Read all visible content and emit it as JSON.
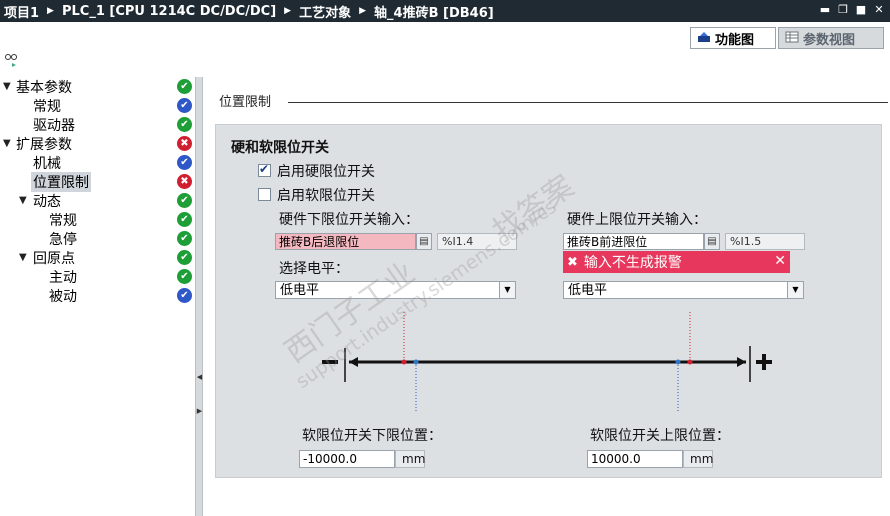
{
  "titlebar": {
    "crumbs": [
      "项目1",
      "PLC_1 [CPU 1214C DC/DC/DC]",
      "工艺对象",
      "轴_4推砖B [DB46]"
    ],
    "win_buttons": [
      "minimize",
      "restore",
      "maximize",
      "close"
    ]
  },
  "tabs": [
    {
      "label": "功能图",
      "icon": "function-view-icon",
      "active": true
    },
    {
      "label": "参数视图",
      "icon": "parameter-view-icon",
      "active": false
    }
  ],
  "tree": {
    "items": [
      {
        "label": "基本参数",
        "level": 0,
        "expanded": true,
        "status": "ok"
      },
      {
        "label": "常规",
        "level": 1,
        "status": "info"
      },
      {
        "label": "驱动器",
        "level": 1,
        "status": "ok"
      },
      {
        "label": "扩展参数",
        "level": 0,
        "expanded": true,
        "status": "err"
      },
      {
        "label": "机械",
        "level": 1,
        "status": "info"
      },
      {
        "label": "位置限制",
        "level": 1,
        "selected": true,
        "status": "err"
      },
      {
        "label": "动态",
        "level": 1,
        "expanded": true,
        "status": "ok"
      },
      {
        "label": "常规",
        "level": 2,
        "status": "ok"
      },
      {
        "label": "急停",
        "level": 2,
        "status": "ok"
      },
      {
        "label": "回原点",
        "level": 1,
        "expanded": true,
        "status": "ok"
      },
      {
        "label": "主动",
        "level": 2,
        "status": "ok"
      },
      {
        "label": "被动",
        "level": 2,
        "status": "info"
      }
    ]
  },
  "main": {
    "section_title": "位置限制",
    "panel_title": "硬和软限位开关",
    "enable_hw": {
      "label": "启用硬限位开关",
      "checked": true
    },
    "enable_sw": {
      "label": "启用软限位开关",
      "checked": false
    },
    "hw_lower": {
      "label": "硬件下限位开关输入：",
      "value": "推砖B后退限位",
      "address": "%I1.4",
      "level_label": "选择电平：",
      "level_value": "低电平"
    },
    "hw_upper": {
      "label": "硬件上限位开关输入：",
      "value": "推砖B前进限位",
      "address": "%I1.5",
      "level_value": "低电平"
    },
    "error_message": "输入不生成报警",
    "sw_lower": {
      "label": "软限位开关下限位置：",
      "value": "-10000.0",
      "unit": "mm"
    },
    "sw_upper": {
      "label": "软限位开关上限位置：",
      "value": "10000.0",
      "unit": "mm"
    }
  },
  "watermark": {
    "brand": "西门子工业",
    "site": "support.industry.siemens.com/cs",
    "tag": "找答案"
  },
  "colors": {
    "titlebar": "#1f2a33",
    "panel": "#dde0e3",
    "error": "#e8375c",
    "ok": "#1e9e36",
    "info": "#2e57c8"
  }
}
